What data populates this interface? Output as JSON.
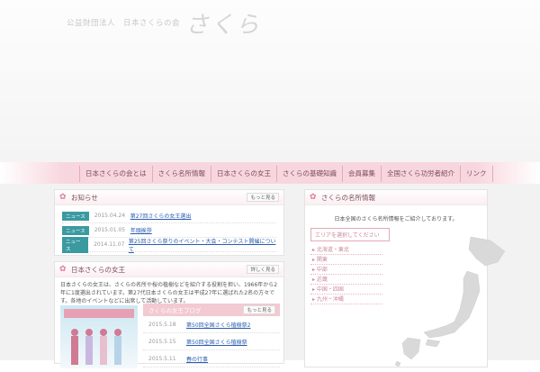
{
  "header": {
    "logo_small": "公益財団法人　日本さくらの会",
    "logo_big": "さくら"
  },
  "nav": [
    "日本さくらの会とは",
    "さくら名所情報",
    "日本さくらの女王",
    "さくらの基礎知識",
    "会員募集",
    "全国さくら功労者紹介",
    "リンク"
  ],
  "news": {
    "title": "お知らせ",
    "more": "もっと見る",
    "items": [
      {
        "badge": "ニュース",
        "date": "2015.04.24",
        "text": "第27回さくらの女王選出"
      },
      {
        "badge": "ニュース",
        "date": "2015.01.05",
        "text": "年頭挨拶"
      },
      {
        "badge": "ニュース",
        "date": "2014.11.07",
        "text": "第25回さくら祭りのイベント・大会・コンテスト開催について"
      }
    ]
  },
  "queen": {
    "title": "日本さくらの女王",
    "more": "詳しく見る",
    "text": "日本さくらの女王は、さくらの名所や桜の植樹などを紹介する役割を担い、1966年から2年に1度選出されています。第27代日本さくらの女王は平成27年に選ばれた2名の方々です。各地のイベントなどに出席して活動しています。"
  },
  "blog": {
    "title": "さくらの女王ブログ",
    "more": "もっと見る",
    "items": [
      {
        "date": "2015.5.18",
        "text": "第50回全国さくら植樹祭2"
      },
      {
        "date": "2015.5.15",
        "text": "第50回全国さくら植樹祭"
      },
      {
        "date": "2015.5.11",
        "text": "春の行事"
      }
    ]
  },
  "meisho": {
    "title": "さくらの名所情報",
    "description": "日本全国のさくら名所情報をご紹介しております。",
    "select_prompt": "エリアを選択してください",
    "regions": [
      "北海道・東北",
      "関東",
      "中部",
      "近畿",
      "中国・四国",
      "九州・沖縄"
    ]
  },
  "colors": {
    "accent": "#e07a92",
    "badge": "#3b9aa0",
    "link": "#2a5db0",
    "nav_band": "#f8d6de"
  }
}
